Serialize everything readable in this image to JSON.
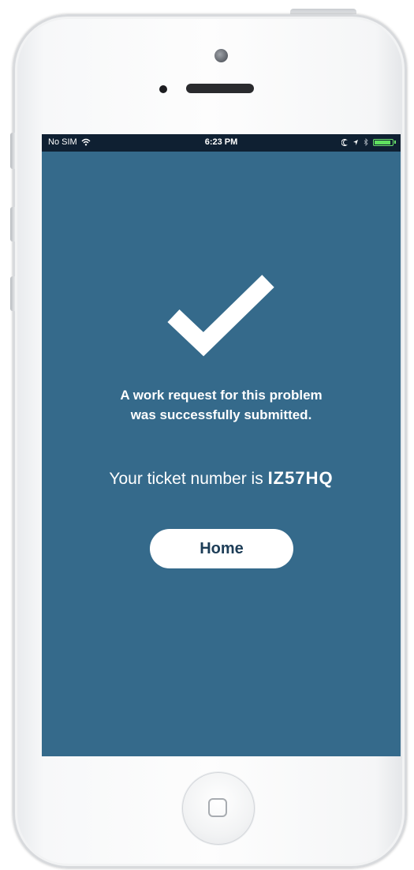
{
  "status_bar": {
    "carrier": "No SIM",
    "time": "6:23 PM",
    "battery_level": 0.9,
    "battery_color": "#5fe05f"
  },
  "icons": {
    "wifi": "wifi-icon",
    "moon": "moon-icon",
    "location": "location-arrow-icon",
    "bluetooth": "bluetooth-icon",
    "battery": "battery-icon",
    "check": "checkmark-icon"
  },
  "confirmation": {
    "message_line1": "A work request for this problem",
    "message_line2": "was successfully submitted.",
    "ticket_prefix": "Your ticket number is ",
    "ticket_code": "IZ57HQ"
  },
  "actions": {
    "home_label": "Home"
  },
  "colors": {
    "screen_background": "#356a8b",
    "status_bar_background": "#0f2032",
    "button_background": "#ffffff",
    "button_text": "#1d3d57"
  }
}
